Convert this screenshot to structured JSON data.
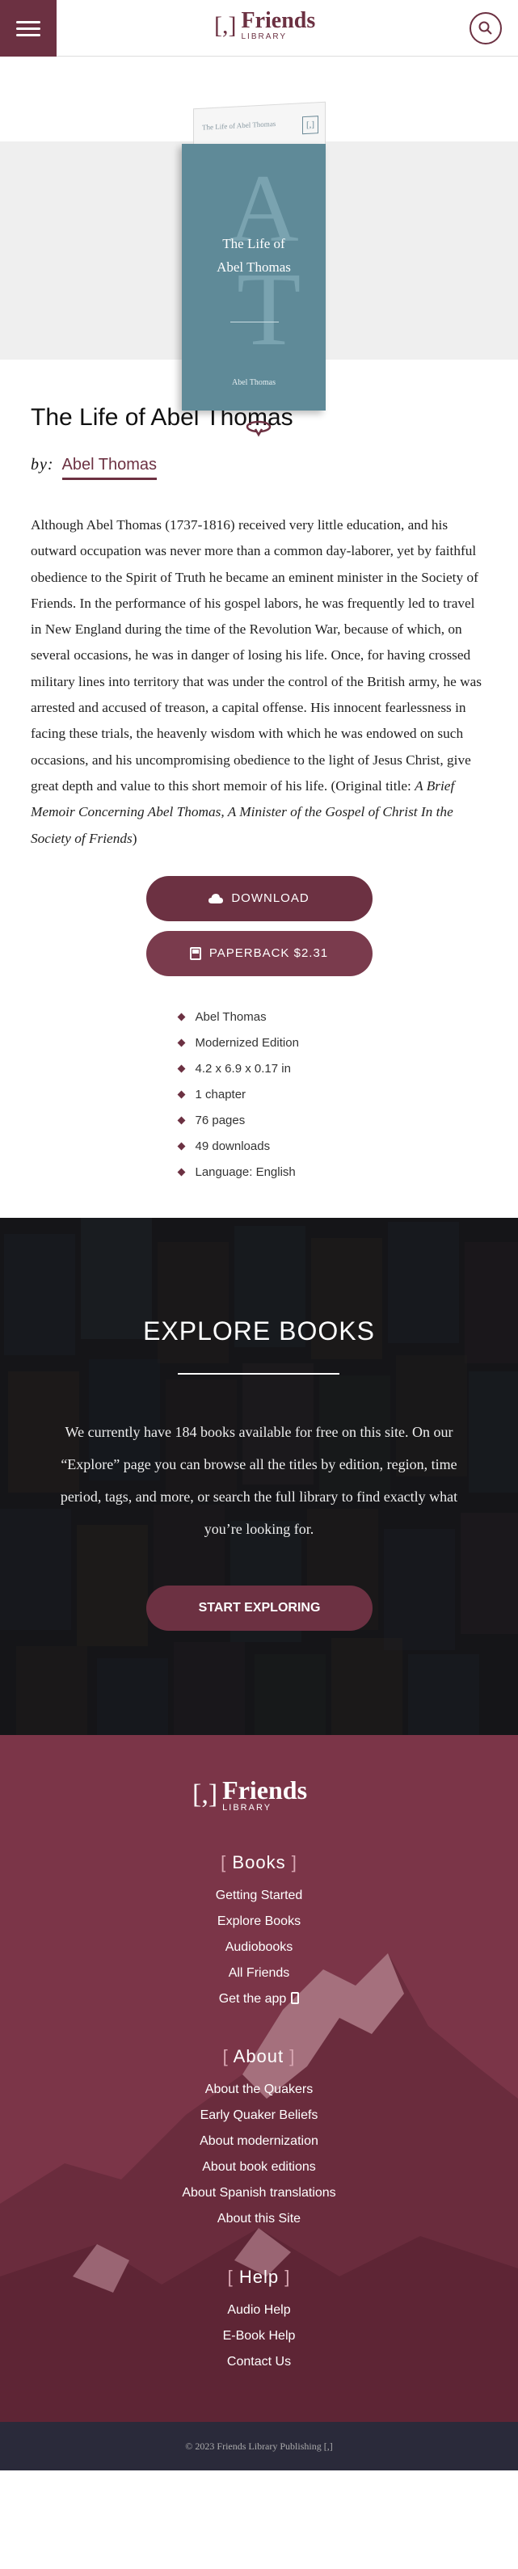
{
  "header": {
    "logo_mark": "[,]",
    "logo_main": "Friends",
    "logo_sub": "LIBRARY"
  },
  "book_cover": {
    "back_title": "The Life of Abel Thomas",
    "mark": "[,]",
    "initial_1": "A",
    "initial_2": "T",
    "title_line1": "The Life of",
    "title_line2": "Abel Thomas",
    "author": "Abel Thomas"
  },
  "main": {
    "title": "The Life of Abel Thomas",
    "by_label": "by:",
    "author": "Abel Thomas",
    "description": "Although Abel Thomas (1737-1816) received very little education, and his outward occupation was never more than a common day-laborer, yet by faithful obedience to the Spirit of Truth he became an eminent minister in the Society of Friends. In the performance of his gospel labors, he was frequently led to travel in New England during the time of the Revolution War, because of which, on several occasions, he was in danger of losing his life. Once, for having crossed military lines into territory that was under the control of the British army, he was arrested and accused of treason, a capital offense. His innocent fearlessness in facing these trials, the heavenly wisdom with which he was endowed on such occasions, and his uncompromising obedience to the light of Jesus Christ, give great depth and value to this short memoir of his life. (Original title: ",
    "original_title": "A Brief Memoir Concerning Abel Thomas, A Minister of the Gospel of Christ In the Society of Friends",
    "desc_end": ")",
    "download_label": "DOWNLOAD",
    "paperback_label": "PAPERBACK $2.31",
    "meta": [
      "Abel Thomas",
      "Modernized Edition",
      "4.2 x 6.9 x 0.17 in",
      "1 chapter",
      "76 pages",
      "49 downloads",
      "Language: English"
    ]
  },
  "explore": {
    "title": "EXPLORE BOOKS",
    "text": "We currently have 184 books available for free on this site. On our “Explore” page you can browse all the titles by edition, region, time period, tags, and more, or search the full library to find exactly what you’re looking for.",
    "button_label": "START EXPLORING"
  },
  "footer": {
    "logo_mark": "[,]",
    "logo_main": "Friends",
    "logo_sub": "LIBRARY",
    "bracket_open": "[",
    "bracket_close": "]",
    "books_heading": "Books",
    "books_links": [
      "Getting Started",
      "Explore Books",
      "Audiobooks",
      "All Friends",
      "Get the app"
    ],
    "about_heading": "About",
    "about_links": [
      "About the Quakers",
      "Early Quaker Beliefs",
      "About modernization",
      "About book editions",
      "About Spanish translations",
      "About this Site"
    ],
    "help_heading": "Help",
    "help_links": [
      "Audio Help",
      "E-Book Help",
      "Contact Us"
    ],
    "copyright": "© 2023 Friends Library Publishing [,]"
  },
  "colors": {
    "brand": "#6c3142",
    "cover": "#5f8a98",
    "footer": "#7b3548",
    "copyright_bar": "#2a2a3a"
  },
  "icons": [
    "hamburger-menu-icon",
    "search-icon",
    "flip-book-icon",
    "cloud-download-icon",
    "book-icon",
    "phone-icon"
  ]
}
